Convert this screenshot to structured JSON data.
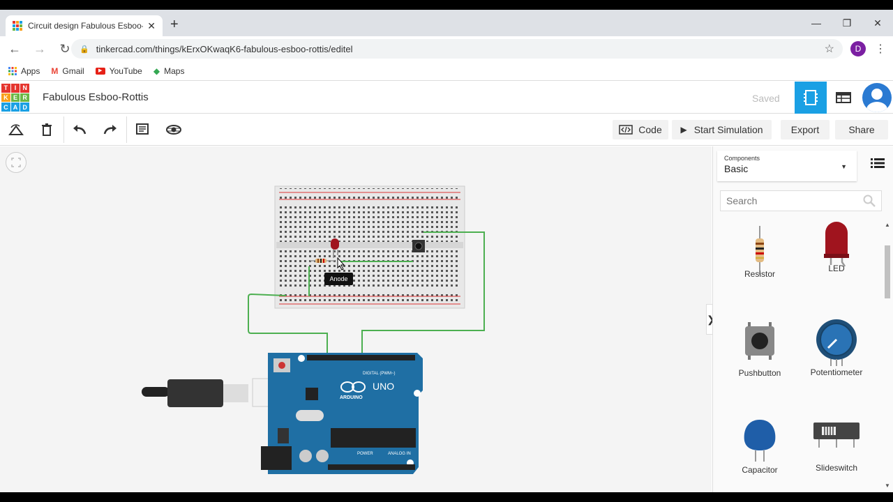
{
  "browser": {
    "tab_title": "Circuit design Fabulous Esboo-Rottis | Tinkercad",
    "url": "tinkercad.com/things/kErxOKwaqK6-fabulous-esboo-rottis/editel",
    "profile_initial": "D",
    "bookmarks": [
      {
        "label": "Apps",
        "icon": "apps-grid-icon"
      },
      {
        "label": "Gmail",
        "icon": "gmail-icon"
      },
      {
        "label": "YouTube",
        "icon": "youtube-icon"
      },
      {
        "label": "Maps",
        "icon": "maps-icon"
      }
    ]
  },
  "app": {
    "logo_letters": [
      "T",
      "I",
      "N",
      "K",
      "E",
      "R",
      "C",
      "A",
      "D"
    ],
    "design_title": "Fabulous Esboo-Rottis",
    "save_status": "Saved"
  },
  "toolbar": {
    "code_label": "Code",
    "start_sim_label": "Start Simulation",
    "export_label": "Export",
    "share_label": "Share"
  },
  "canvas": {
    "tooltip": "Anode",
    "board_brand": "ARDUINO",
    "board_model": "UNO",
    "digital_label": "DIGITAL (PWM~)",
    "power_label": "POWER",
    "analog_label": "ANALOG IN"
  },
  "panel": {
    "components_label": "Components",
    "category": "Basic",
    "search_placeholder": "Search",
    "items": [
      {
        "label": "Resistor",
        "icon": "resistor-icon"
      },
      {
        "label": "LED",
        "icon": "led-icon"
      },
      {
        "label": "Pushbutton",
        "icon": "pushbutton-icon"
      },
      {
        "label": "Potentiometer",
        "icon": "potentiometer-icon"
      },
      {
        "label": "Capacitor",
        "icon": "capacitor-icon"
      },
      {
        "label": "Slideswitch",
        "icon": "slideswitch-icon"
      }
    ]
  },
  "colors": {
    "accent": "#1aa0e4",
    "wire": "#4caf50",
    "arduino": "#1f6fa4",
    "led": "#a0141e"
  }
}
